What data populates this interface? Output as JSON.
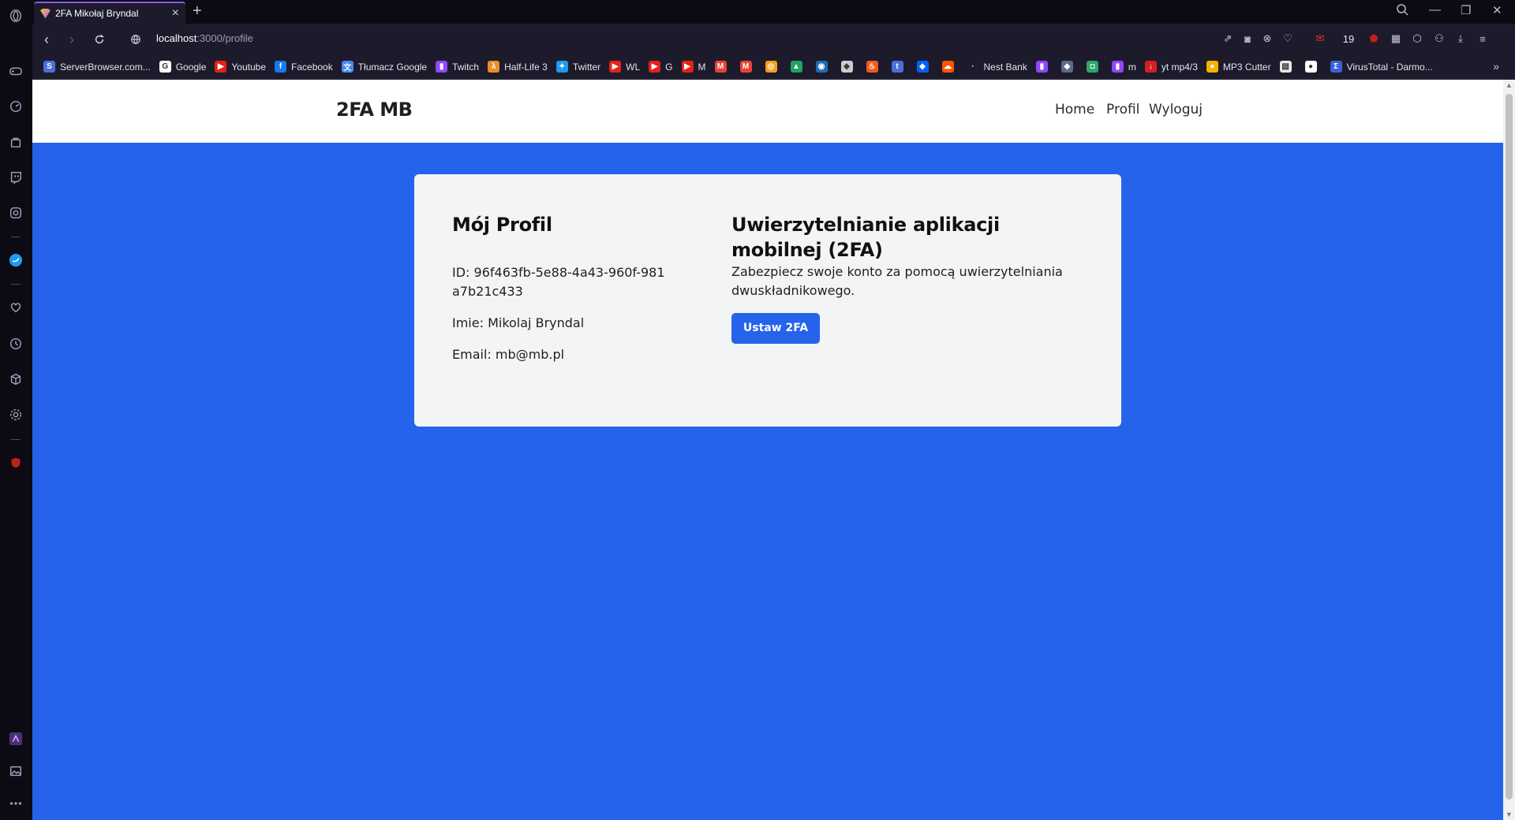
{
  "browser": {
    "tab_title": "2FA Mikołaj Bryndal",
    "new_tab_symbol": "+",
    "url_host": "localhost",
    "url_path": ":3000/profile",
    "notification_count": "19",
    "bookmarks": [
      {
        "label": "ServerBrowser.com...",
        "icon": "serverbrowser-icon",
        "color": "#4a6fd8",
        "glyph": "S"
      },
      {
        "label": "Google",
        "icon": "google-icon",
        "color": "#ffffff",
        "glyph": "G"
      },
      {
        "label": "Youtube",
        "icon": "youtube-icon",
        "color": "#e62117",
        "glyph": "▶"
      },
      {
        "label": "Facebook",
        "icon": "facebook-icon",
        "color": "#1877f2",
        "glyph": "f"
      },
      {
        "label": "Tłumacz Google",
        "icon": "translate-icon",
        "color": "#4a88f0",
        "glyph": "文"
      },
      {
        "label": "Twitch",
        "icon": "twitch-icon",
        "color": "#9146ff",
        "glyph": "▮"
      },
      {
        "label": "Half-Life 3",
        "icon": "halflife-icon",
        "color": "#e8902a",
        "glyph": "λ"
      },
      {
        "label": "Twitter",
        "icon": "twitter-icon",
        "color": "#1d9bf0",
        "glyph": "✦"
      },
      {
        "label": "WL",
        "icon": "youtube-icon",
        "color": "#e62117",
        "glyph": "▶"
      },
      {
        "label": "G",
        "icon": "youtube-icon",
        "color": "#e62117",
        "glyph": "▶"
      },
      {
        "label": "M",
        "icon": "youtube-icon",
        "color": "#e62117",
        "glyph": "▶"
      }
    ],
    "bookmarks_tail": [
      {
        "label": "Nest Bank",
        "icon": "nestbank-icon",
        "color": "#1d1b2b",
        "glyph": "·"
      },
      {
        "label": "",
        "icon": "twitch-icon",
        "color": "#9146ff",
        "glyph": "▮"
      },
      {
        "label": "",
        "icon": "shield-icon",
        "color": "#5a6a8a",
        "glyph": "◆"
      },
      {
        "label": "",
        "icon": "app-icon",
        "color": "#2aa86b",
        "glyph": "◘"
      },
      {
        "label": "m",
        "icon": "twitch-icon",
        "color": "#9146ff",
        "glyph": "▮"
      },
      {
        "label": "yt mp4/3",
        "icon": "download-red-icon",
        "color": "#d42020",
        "glyph": "↓"
      },
      {
        "label": "MP3 Cutter",
        "icon": "mp3cutter-icon",
        "color": "#f4b400",
        "glyph": "●"
      },
      {
        "label": "",
        "icon": "file-icon",
        "color": "#e8e8e8",
        "glyph": "▤"
      },
      {
        "label": "",
        "icon": "github-icon",
        "color": "#ffffff",
        "glyph": "●"
      },
      {
        "label": "VirusTotal - Darmo...",
        "icon": "virustotal-icon",
        "color": "#3b61d8",
        "glyph": "Σ"
      }
    ],
    "bookmarks_more": "»"
  },
  "site": {
    "brand": "2FA MB",
    "nav": [
      "Home",
      "Profil",
      "Wyloguj"
    ]
  },
  "profile": {
    "heading": "Mój Profil",
    "id_line": "ID: 96f463fb-5e88-4a43-960f-981a7b21c433",
    "name_line": "Imie: Mikolaj Bryndal",
    "email_line": "Email: mb@mb.pl"
  },
  "twofa": {
    "heading": "Uwierzytelnianie aplikacji mobilnej (2FA)",
    "description": "Zabezpiecz swoje konto za pomocą uwierzytelniania dwuskładnikowego.",
    "button_label": "Ustaw 2FA"
  },
  "colors": {
    "page_background": "#2563eb",
    "card_background": "#f3f4f6",
    "button_background": "#2563eb"
  }
}
